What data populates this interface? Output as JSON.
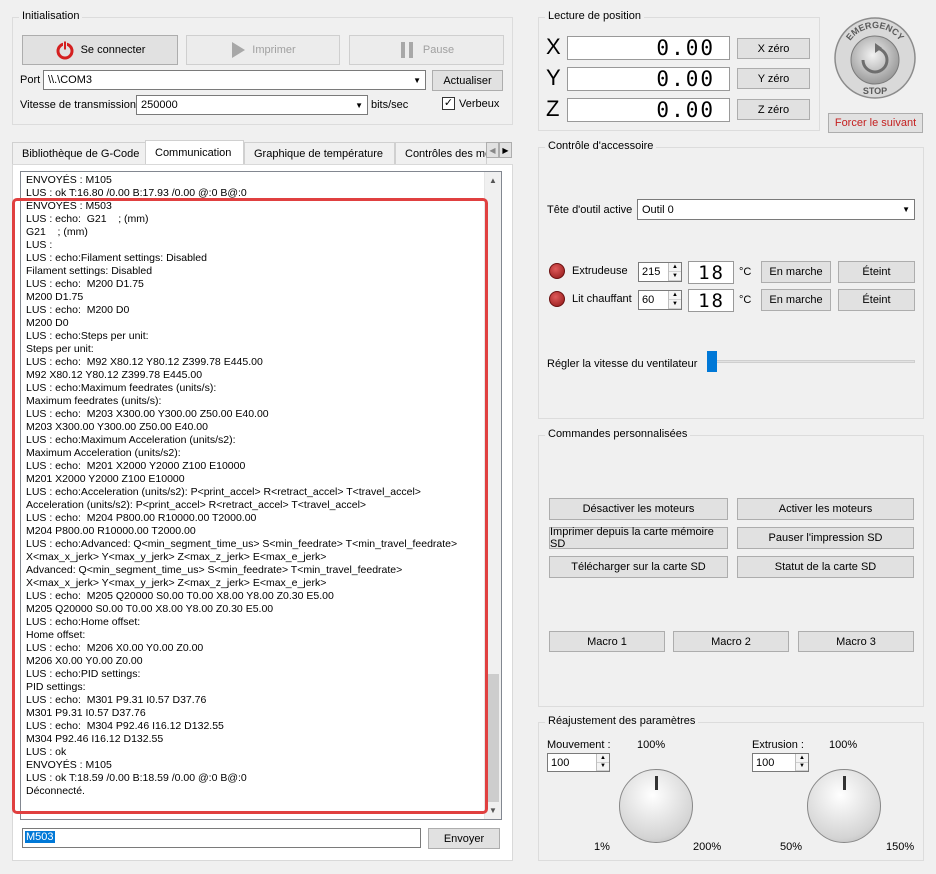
{
  "init": {
    "title": "Initialisation",
    "connect_label": "Se connecter",
    "print_label": "Imprimer",
    "pause_label": "Pause",
    "port_label": "Port",
    "port_value": "\\\\.\\COM3",
    "refresh_label": "Actualiser",
    "baud_label": "Vitesse de transmission",
    "baud_value": "250000",
    "baud_unit": "bits/sec",
    "verbose_label": "Verbeux",
    "verbose_checked": true
  },
  "tabs": [
    "Bibliothèque de G-Code",
    "Communication",
    "Graphique de température",
    "Contrôles des mo"
  ],
  "active_tab": "Communication",
  "log": [
    "ENVOYÉS : M105",
    "LUS : ok T:16.80 /0.00 B:17.93 /0.00 @:0 B@:0",
    "ENVOYÉS : M503",
    "LUS : echo:  G21    ; (mm)",
    "G21    ; (mm)",
    "LUS :",
    "LUS : echo:Filament settings: Disabled",
    "Filament settings: Disabled",
    "LUS : echo:  M200 D1.75",
    "M200 D1.75",
    "LUS : echo:  M200 D0",
    "M200 D0",
    "LUS : echo:Steps per unit:",
    "Steps per unit:",
    "LUS : echo:  M92 X80.12 Y80.12 Z399.78 E445.00",
    "M92 X80.12 Y80.12 Z399.78 E445.00",
    "LUS : echo:Maximum feedrates (units/s):",
    "Maximum feedrates (units/s):",
    "LUS : echo:  M203 X300.00 Y300.00 Z50.00 E40.00",
    "M203 X300.00 Y300.00 Z50.00 E40.00",
    "LUS : echo:Maximum Acceleration (units/s2):",
    "Maximum Acceleration (units/s2):",
    "LUS : echo:  M201 X2000 Y2000 Z100 E10000",
    "M201 X2000 Y2000 Z100 E10000",
    "LUS : echo:Acceleration (units/s2): P<print_accel> R<retract_accel> T<travel_accel>",
    "Acceleration (units/s2): P<print_accel> R<retract_accel> T<travel_accel>",
    "LUS : echo:  M204 P800.00 R10000.00 T2000.00",
    "M204 P800.00 R10000.00 T2000.00",
    "LUS : echo:Advanced: Q<min_segment_time_us> S<min_feedrate> T<min_travel_feedrate>",
    "X<max_x_jerk> Y<max_y_jerk> Z<max_z_jerk> E<max_e_jerk>",
    "Advanced: Q<min_segment_time_us> S<min_feedrate> T<min_travel_feedrate>",
    "X<max_x_jerk> Y<max_y_jerk> Z<max_z_jerk> E<max_e_jerk>",
    "LUS : echo:  M205 Q20000 S0.00 T0.00 X8.00 Y8.00 Z0.30 E5.00",
    "M205 Q20000 S0.00 T0.00 X8.00 Y8.00 Z0.30 E5.00",
    "LUS : echo:Home offset:",
    "Home offset:",
    "LUS : echo:  M206 X0.00 Y0.00 Z0.00",
    "M206 X0.00 Y0.00 Z0.00",
    "LUS : echo:PID settings:",
    "PID settings:",
    "LUS : echo:  M301 P9.31 I0.57 D37.76",
    "M301 P9.31 I0.57 D37.76",
    "LUS : echo:  M304 P92.46 I16.12 D132.55",
    "M304 P92.46 I16.12 D132.55",
    "LUS : ok",
    "ENVOYÉS : M105",
    "LUS : ok T:18.59 /0.00 B:18.59 /0.00 @:0 B@:0",
    "Déconnecté."
  ],
  "command": {
    "value": "M503",
    "send_label": "Envoyer"
  },
  "position": {
    "title": "Lecture de position",
    "axes": [
      {
        "label": "X",
        "value": "0.00",
        "zero_label": "X zéro"
      },
      {
        "label": "Y",
        "value": "0.00",
        "zero_label": "Y zéro"
      },
      {
        "label": "Z",
        "value": "0.00",
        "zero_label": "Z zéro"
      }
    ]
  },
  "emergency": {
    "line1": "EMERGENCY",
    "line2": "STOP",
    "force_label": "Forcer le suivant"
  },
  "accessory": {
    "title": "Contrôle d'accessoire",
    "tool_label": "Tête d'outil active",
    "tool_value": "Outil 0",
    "extruder": {
      "label": "Extrudeuse",
      "target": "215",
      "current": "18",
      "unit": "°C",
      "on_label": "En marche",
      "off_label": "Éteint"
    },
    "bed": {
      "label": "Lit chauffant",
      "target": "60",
      "current": "18",
      "unit": "°C",
      "on_label": "En marche",
      "off_label": "Éteint"
    },
    "fan_label": "Régler la vitesse du ventilateur",
    "fan_level": 0
  },
  "custom": {
    "title": "Commandes personnalisées",
    "buttons": [
      "Désactiver les moteurs",
      "Activer les moteurs",
      "Imprimer depuis la carte mémoire SD",
      "Pauser l'impression SD",
      "Télécharger sur la carte SD",
      "Statut de la carte SD"
    ],
    "macros": [
      "Macro 1",
      "Macro 2",
      "Macro 3"
    ]
  },
  "adjust": {
    "title": "Réajustement des paramètres",
    "movement": {
      "label": "Mouvement :",
      "value": "100",
      "top": "100%",
      "min": "1%",
      "max": "200%"
    },
    "extrusion": {
      "label": "Extrusion :",
      "value": "100",
      "top": "100%",
      "min": "50%",
      "max": "150%"
    }
  },
  "colors": {
    "highlight": "#e04040",
    "accent": "#0078d7",
    "power_icon": "#d41f1f"
  }
}
